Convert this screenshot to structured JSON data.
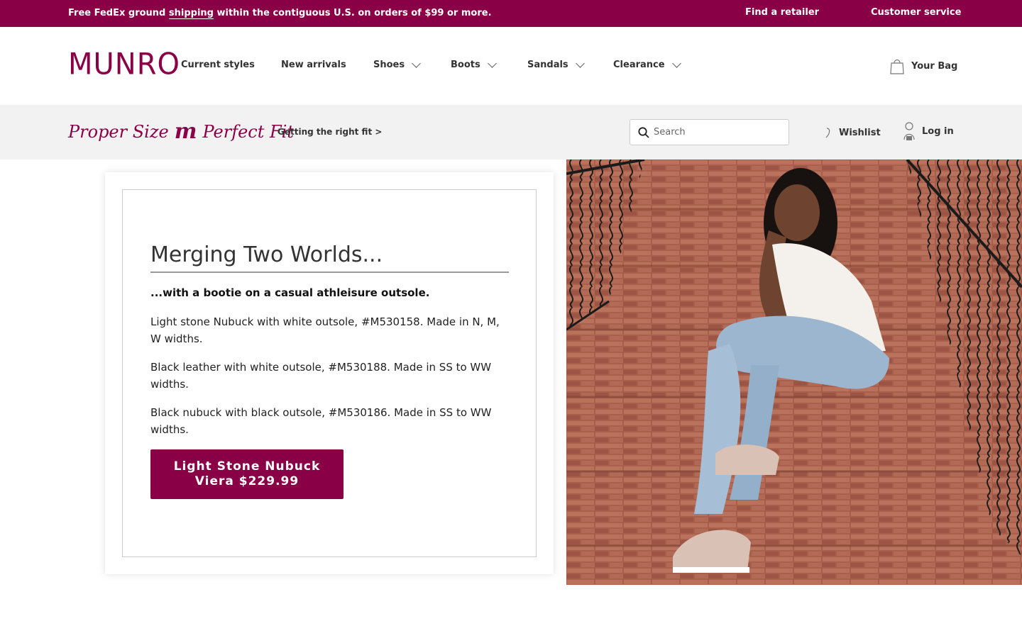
{
  "promo": {
    "msg_before": "Free FedEx ground ",
    "msg_link": "shipping",
    "msg_after": " within the contiguous U.S. on orders of $99 or more.",
    "find_retailer": "Find a retailer",
    "customer_service": "Customer service",
    "bg_color": "#8a0046"
  },
  "header": {
    "logo": "MUNRO",
    "nav": [
      {
        "label": "Current styles"
      },
      {
        "label": "New arrivals"
      },
      {
        "label": "Shoes"
      },
      {
        "label": "Boots"
      },
      {
        "label": "Sandals"
      },
      {
        "label": "Clearance"
      }
    ],
    "bag_label": "Your Bag"
  },
  "fitbar": {
    "tag_left": "Proper Size",
    "tag_mark": "m",
    "tag_right": "Perfect Fit",
    "link": "Getting the right fit >",
    "search_placeholder": "Search",
    "wishlist": "Wishlist",
    "login": "Log in"
  },
  "content": {
    "headline": "Merging Two Worlds...",
    "subhead": "...with a bootie on a casual athleisure outsole.",
    "paragraphs": [
      "Light stone Nubuck with white outsole, #M530158. Made in N, M, W widths.",
      "Black leather with white outsole, #M530188. Made in SS to WW widths.",
      "Black nubuck with black outsole, #M530186. Made in SS to WW widths."
    ],
    "cta_line1": "Light Stone Nubuck",
    "cta_line2": "Viera $229.99"
  },
  "colors": {
    "brand": "#8a0046"
  }
}
